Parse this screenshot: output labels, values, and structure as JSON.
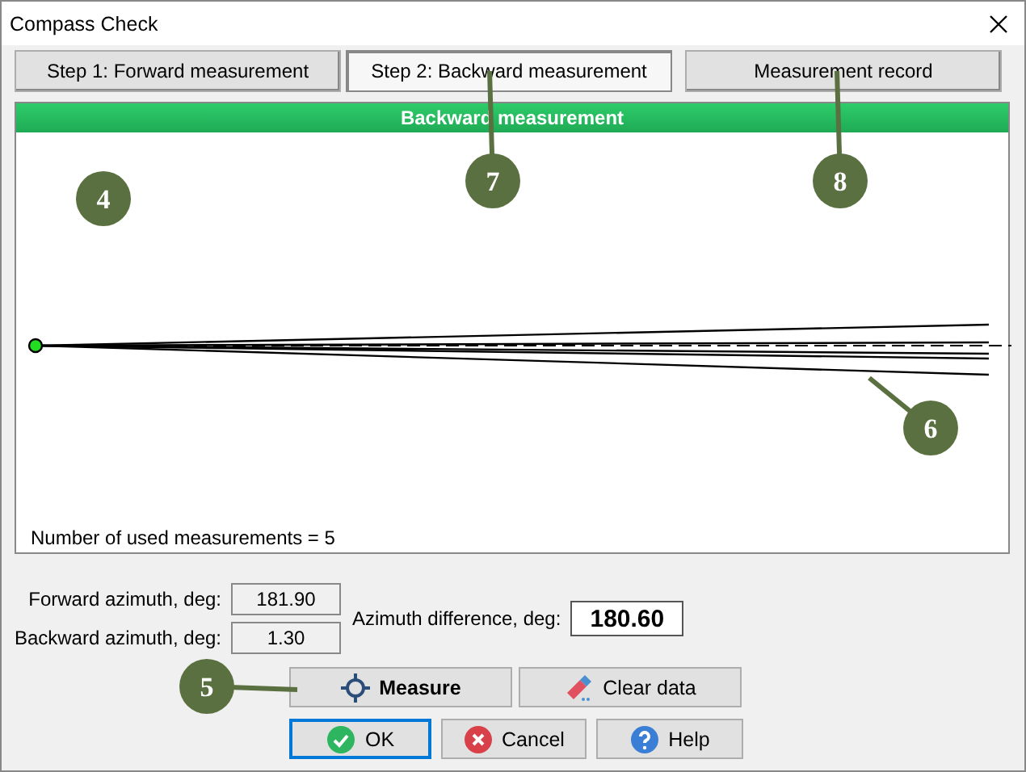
{
  "window": {
    "title": "Compass Check"
  },
  "tabs": [
    {
      "label": "Step 1: Forward measurement",
      "selected": false
    },
    {
      "label": "Step 2: Backward measurement",
      "selected": true
    },
    {
      "label": "Measurement record",
      "selected": false
    }
  ],
  "panel": {
    "header": "Backward measurement",
    "footer": "Number of used measurements = 5"
  },
  "fields": [
    {
      "label": "Forward azimuth, deg:",
      "value": "181.90"
    },
    {
      "label": "Backward azimuth, deg:",
      "value": "1.30"
    }
  ],
  "difference": {
    "label": "Azimuth difference, deg:",
    "value": "180.60"
  },
  "action_buttons": [
    {
      "label": "Measure",
      "kind": "crosshair",
      "bold": true,
      "default": false
    },
    {
      "label": "Clear data",
      "kind": "eraser",
      "bold": false,
      "default": false
    }
  ],
  "dialog_buttons": [
    {
      "label": "OK",
      "kind": "ok",
      "bold": false,
      "default": true
    },
    {
      "label": "Cancel",
      "kind": "cancel",
      "bold": false,
      "default": false
    },
    {
      "label": "Help",
      "kind": "help",
      "bold": false,
      "default": false
    }
  ],
  "callouts": [
    {
      "label": "4",
      "leader": false
    },
    {
      "label": "7",
      "leader": true
    },
    {
      "label": "8",
      "leader": true
    },
    {
      "label": "6",
      "leader": true
    },
    {
      "label": "5",
      "leader": true
    }
  ]
}
